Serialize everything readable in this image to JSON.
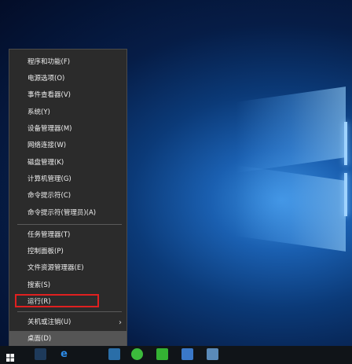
{
  "menu": {
    "items": [
      {
        "label": "程序和功能(F)"
      },
      {
        "label": "电源选项(O)"
      },
      {
        "label": "事件查看器(V)"
      },
      {
        "label": "系统(Y)"
      },
      {
        "label": "设备管理器(M)"
      },
      {
        "label": "网络连接(W)"
      },
      {
        "label": "磁盘管理(K)"
      },
      {
        "label": "计算机管理(G)"
      },
      {
        "label": "命令提示符(C)"
      },
      {
        "label": "命令提示符(管理员)(A)"
      },
      {
        "label": "任务管理器(T)"
      },
      {
        "label": "控制面板(P)"
      },
      {
        "label": "文件资源管理器(E)"
      },
      {
        "label": "搜索(S)"
      },
      {
        "label": "运行(R)"
      },
      {
        "label": "关机或注销(U)"
      },
      {
        "label": "桌面(D)"
      }
    ],
    "submenu_arrow": "›",
    "selected_item": "桌面(D)",
    "highlighted_item": "运行(R)",
    "highlight_color": "#e02020"
  },
  "taskbar": {
    "icons": [
      "windows-start-icon",
      "edge-icon",
      "app-icon",
      "qq-browser-icon",
      "iqiyi-icon",
      "notepad-icon",
      "pen-app-icon"
    ]
  },
  "colors": {
    "menu_bg": "#2b2b2b",
    "menu_text": "#f0f0f0",
    "selected_bg": "#555555",
    "desktop_accent": "#1a5fb0"
  }
}
